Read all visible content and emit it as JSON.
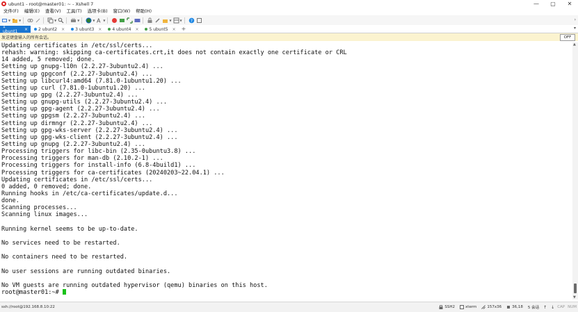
{
  "window": {
    "title": "ubunt1 - root@master01: ~ - Xshell 7",
    "controls": [
      "—",
      "▢",
      "✕"
    ]
  },
  "menu": [
    "文件(F)",
    "编辑(E)",
    "查看(V)",
    "工具(T)",
    "选项卡(B)",
    "窗口(W)",
    "帮助(H)"
  ],
  "tabs": [
    {
      "label": "1 ubunt1",
      "active": true,
      "dot": "",
      "close": "×"
    },
    {
      "label": "2 ubunt2",
      "active": false,
      "dot": "#1e88e5",
      "close": "×"
    },
    {
      "label": "3 ubunt3",
      "active": false,
      "dot": "#1e88e5",
      "close": "×"
    },
    {
      "label": "4 ubunt4",
      "active": false,
      "dot": "#43a047",
      "close": "×"
    },
    {
      "label": "5 ubunt5",
      "active": false,
      "dot": "#43a047",
      "close": "×"
    }
  ],
  "tab_add": "+",
  "compose": {
    "text": "发送键盘输入的所有会话。",
    "off_label": "OFF"
  },
  "terminal": {
    "lines": [
      "Updating certificates in /etc/ssl/certs...",
      "rehash: warning: skipping ca-certificates.crt,it does not contain exactly one certificate or CRL",
      "14 added, 5 removed; done.",
      "Setting up gnupg-l10n (2.2.27-3ubuntu2.4) ...",
      "Setting up gpgconf (2.2.27-3ubuntu2.4) ...",
      "Setting up libcurl4:amd64 (7.81.0-1ubuntu1.20) ...",
      "Setting up curl (7.81.0-1ubuntu1.20) ...",
      "Setting up gpg (2.2.27-3ubuntu2.4) ...",
      "Setting up gnupg-utils (2.2.27-3ubuntu2.4) ...",
      "Setting up gpg-agent (2.2.27-3ubuntu2.4) ...",
      "Setting up gpgsm (2.2.27-3ubuntu2.4) ...",
      "Setting up dirmngr (2.2.27-3ubuntu2.4) ...",
      "Setting up gpg-wks-server (2.2.27-3ubuntu2.4) ...",
      "Setting up gpg-wks-client (2.2.27-3ubuntu2.4) ...",
      "Setting up gnupg (2.2.27-3ubuntu2.4) ...",
      "Processing triggers for libc-bin (2.35-0ubuntu3.8) ...",
      "Processing triggers for man-db (2.10.2-1) ...",
      "Processing triggers for install-info (6.8-4build1) ...",
      "Processing triggers for ca-certificates (20240203~22.04.1) ...",
      "Updating certificates in /etc/ssl/certs...",
      "0 added, 0 removed; done.",
      "Running hooks in /etc/ca-certificates/update.d...",
      "done.",
      "Scanning processes...",
      "Scanning linux images...",
      "",
      "Running kernel seems to be up-to-date.",
      "",
      "No services need to be restarted.",
      "",
      "No containers need to be restarted.",
      "",
      "No user sessions are running outdated binaries.",
      "",
      "No VM guests are running outdated hypervisor (qemu) binaries on this host."
    ],
    "prompt": "root@master01:~# "
  },
  "status": {
    "connection": "ssh://root@192.168.8.10:22",
    "protocol": "SSH2",
    "terminal_type": "xterm",
    "size": "157x36",
    "cursor_pos": "36,18",
    "sessions": "5 会话",
    "caps": "CAP",
    "num": "NUM"
  },
  "colors": {
    "active_tab": "#1976d2",
    "compose_bg": "#fbf3cf",
    "cursor": "#19c219"
  }
}
